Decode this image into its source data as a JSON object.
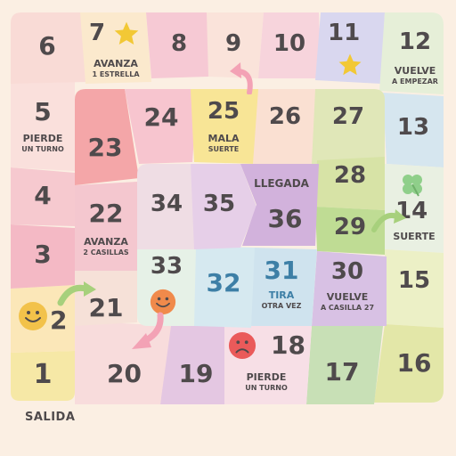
{
  "start_label": "SALIDA",
  "squares": {
    "s1": {
      "num": "1"
    },
    "s2": {
      "num": "2"
    },
    "s3": {
      "num": "3"
    },
    "s4": {
      "num": "4"
    },
    "s5": {
      "num": "5",
      "l1": "PIERDE",
      "l2": "UN TURNO"
    },
    "s6": {
      "num": "6"
    },
    "s7": {
      "num": "7",
      "l1": "AVANZA",
      "l2": "1 ESTRELLA"
    },
    "s8": {
      "num": "8"
    },
    "s9": {
      "num": "9"
    },
    "s10": {
      "num": "10"
    },
    "s11": {
      "num": "11"
    },
    "s12": {
      "num": "12",
      "l1": "VUELVE",
      "l2": "A EMPEZAR"
    },
    "s13": {
      "num": "13"
    },
    "s14": {
      "num": "14",
      "l1": "SUERTE"
    },
    "s15": {
      "num": "15"
    },
    "s16": {
      "num": "16"
    },
    "s17": {
      "num": "17"
    },
    "s18": {
      "num": "18",
      "l1": "PIERDE",
      "l2": "UN TURNO"
    },
    "s19": {
      "num": "19"
    },
    "s20": {
      "num": "20"
    },
    "s21": {
      "num": "21"
    },
    "s22": {
      "num": "22",
      "l1": "AVANZA",
      "l2": "2 CASILLAS"
    },
    "s23": {
      "num": "23"
    },
    "s24": {
      "num": "24"
    },
    "s25": {
      "num": "25",
      "l1": "MALA",
      "l2": "SUERTE"
    },
    "s26": {
      "num": "26"
    },
    "s27": {
      "num": "27"
    },
    "s28": {
      "num": "28"
    },
    "s29": {
      "num": "29"
    },
    "s30": {
      "num": "30",
      "l1": "VUELVE",
      "l2": "A CASILLA 27"
    },
    "s31": {
      "num": "31",
      "l1": "TIRA",
      "l2": "OTRA VEZ"
    },
    "s32": {
      "num": "32"
    },
    "s33": {
      "num": "33"
    },
    "s34": {
      "num": "34"
    },
    "s35": {
      "num": "35"
    },
    "s36": {
      "num": "36",
      "l1": "LLEGADA"
    }
  },
  "icons": {
    "star": "star-icon",
    "smiley": "smiley-face-icon",
    "sad": "sad-face-icon",
    "clover": "four-leaf-clover-icon",
    "arrow": "arrow-icon"
  },
  "colors": {
    "background": "#fbefe3",
    "pink": "#f6c9cf",
    "peach": "#f9dbcc",
    "yellow": "#f6e89e",
    "blue": "#cfe2ee",
    "lilac": "#ddc8e8",
    "green": "#dde9b8",
    "cream": "#f3eed8",
    "text": "#4f4a4c",
    "accent_blue": "#3d7fa6"
  }
}
